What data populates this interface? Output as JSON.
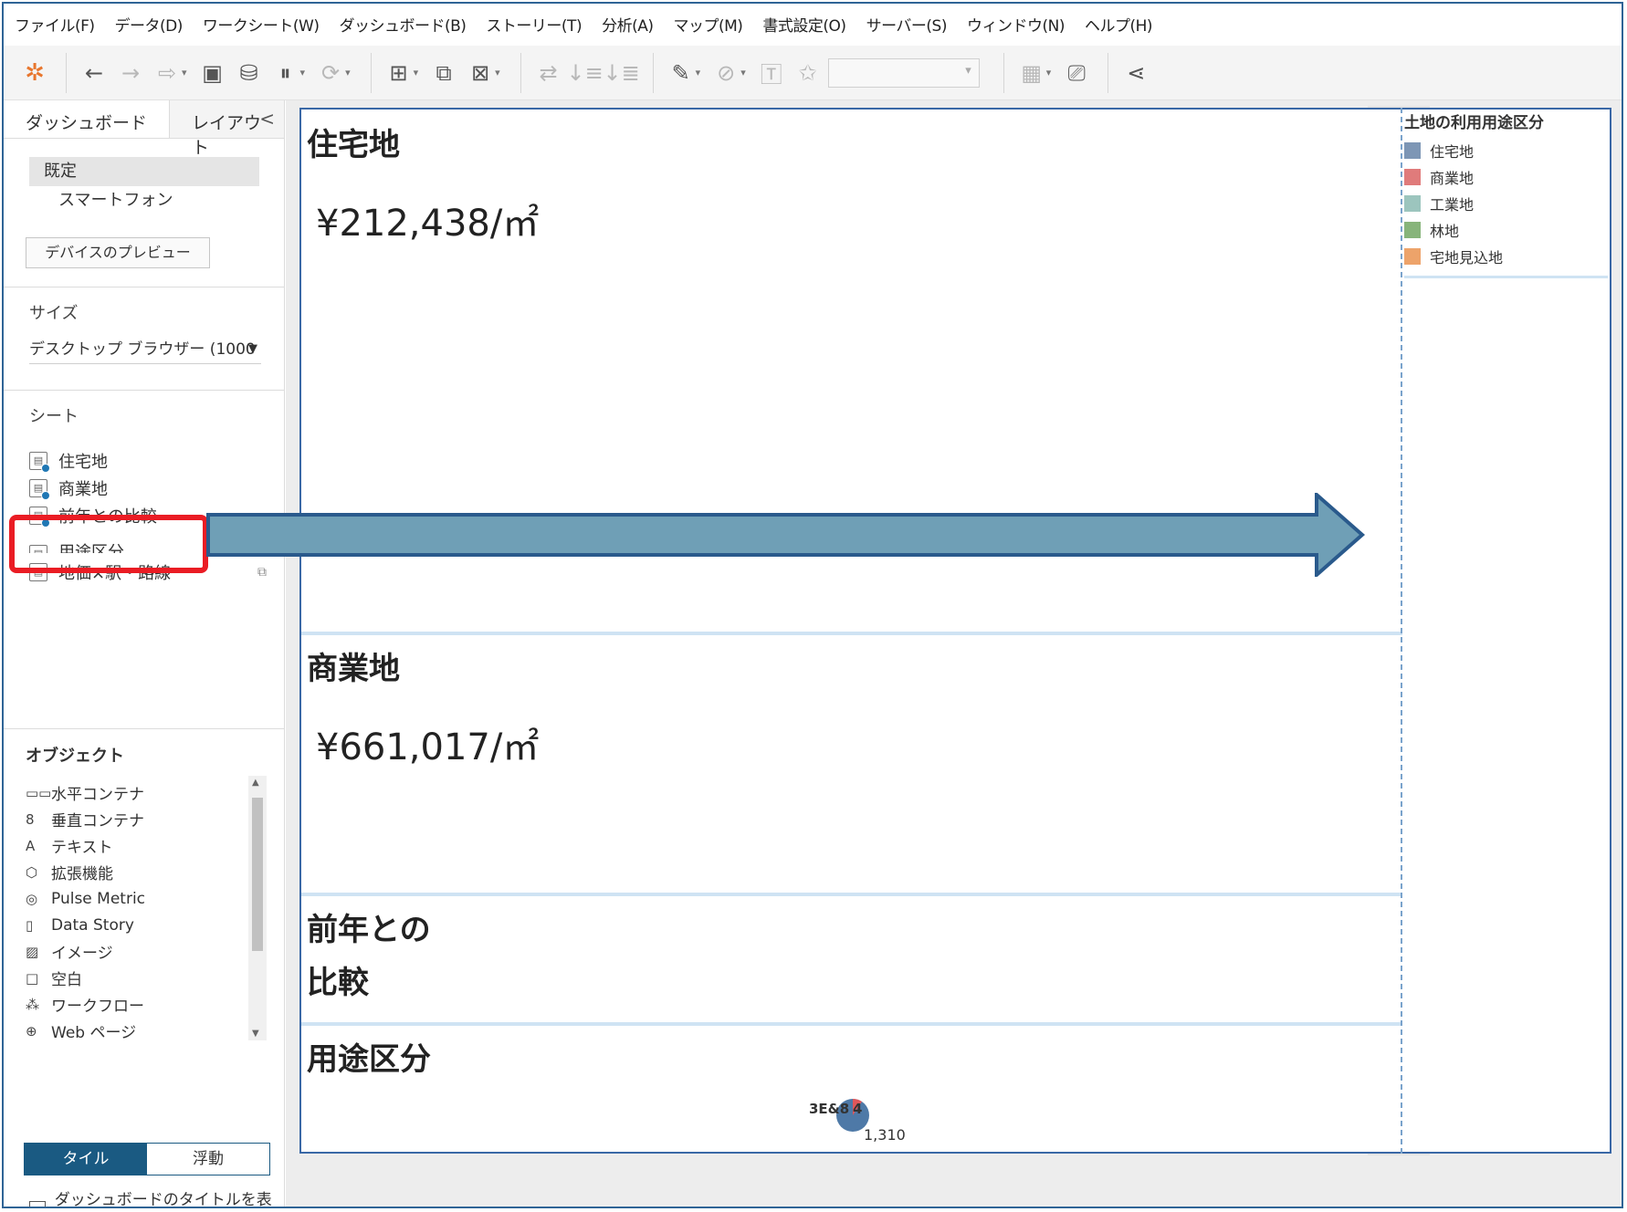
{
  "menubar": {
    "items": [
      "ファイル(F)",
      "データ(D)",
      "ワークシート(W)",
      "ダッシュボード(B)",
      "ストーリー(T)",
      "分析(A)",
      "マップ(M)",
      "書式設定(O)",
      "サーバー(S)",
      "ウィンドウ(N)",
      "ヘルプ(H)"
    ]
  },
  "toolbar": {
    "logo_icon": "tableau-logo-icon",
    "icons": [
      "undo-icon",
      "redo-icon",
      "replay-icon",
      "save-icon",
      "new-datasource-icon",
      "pause-updates-icon",
      "refresh-icon",
      "new-worksheet-icon",
      "duplicate-icon",
      "clear-sheet-icon",
      "swap-icon",
      "sort-ascending-icon",
      "sort-descending-icon",
      "highlight-icon",
      "group-icon",
      "labels-icon",
      "pin-icon",
      "show-me-icon",
      "presentation-icon",
      "share-icon"
    ]
  },
  "left_pane": {
    "tabs": {
      "dashboard": "ダッシュボード",
      "layout": "レイアウト",
      "collapse": "<"
    },
    "devices": {
      "default": "既定",
      "phone": "スマートフォン",
      "preview_button": "デバイスのプレビュー"
    },
    "size": {
      "title": "サイズ",
      "value": "デスクトップ ブラウザー (1000 ···"
    },
    "sheets": {
      "title": "シート",
      "items": [
        "住宅地",
        "商業地",
        "前年との比較",
        "用途区分",
        "地価×駅・路線"
      ]
    },
    "objects": {
      "title": "オブジェクト",
      "items": [
        {
          "icon": "horizontal-container-icon",
          "glyph": "▭▭",
          "label": "水平コンテナ"
        },
        {
          "icon": "vertical-container-icon",
          "glyph": "8",
          "label": "垂直コンテナ"
        },
        {
          "icon": "text-icon",
          "glyph": "A",
          "label": "テキスト"
        },
        {
          "icon": "extension-icon",
          "glyph": "⬡",
          "label": "拡張機能"
        },
        {
          "icon": "pulse-metric-icon",
          "glyph": "◎",
          "label": "Pulse Metric"
        },
        {
          "icon": "data-story-icon",
          "glyph": "▯",
          "label": "Data Story"
        },
        {
          "icon": "image-icon",
          "glyph": "▨",
          "label": "イメージ"
        },
        {
          "icon": "blank-icon",
          "glyph": "□",
          "label": "空白"
        },
        {
          "icon": "workflow-icon",
          "glyph": "⁂",
          "label": "ワークフロー"
        },
        {
          "icon": "web-page-icon",
          "glyph": "⊕",
          "label": "Web ページ"
        }
      ]
    },
    "mode": {
      "tiled": "タイル",
      "floating": "浮動"
    },
    "show_title": "ダッシュボードのタイトルを表示"
  },
  "dashboard": {
    "sections": {
      "residential": {
        "title": "住宅地",
        "value": "¥212,438/㎡"
      },
      "commercial": {
        "title": "商業地",
        "value": "¥661,017/㎡"
      },
      "comparison": {
        "title_line1": "前年との",
        "title_line2": "比較"
      },
      "usage": {
        "title": "用途区分",
        "pie_label_overlap": "3E&8",
        "pie_label_small": "4",
        "pie_label_main": "1,310"
      }
    },
    "legend": {
      "title": "土地の利用用途区分",
      "items": [
        {
          "label": "住宅地",
          "color": "#7d96b5"
        },
        {
          "label": "商業地",
          "color": "#e07b7b"
        },
        {
          "label": "工業地",
          "color": "#9cc5be"
        },
        {
          "label": "林地",
          "color": "#87b47a"
        },
        {
          "label": "宅地見込地",
          "color": "#eda36a"
        }
      ]
    }
  },
  "colors": {
    "accent": "#1a5a82",
    "highlight_box": "#ea1c24",
    "arrow_fill": "#6f9fb6",
    "arrow_stroke": "#2a5a8c",
    "pie_main": "#4e79a7",
    "pie_secondary": "#e15759"
  }
}
